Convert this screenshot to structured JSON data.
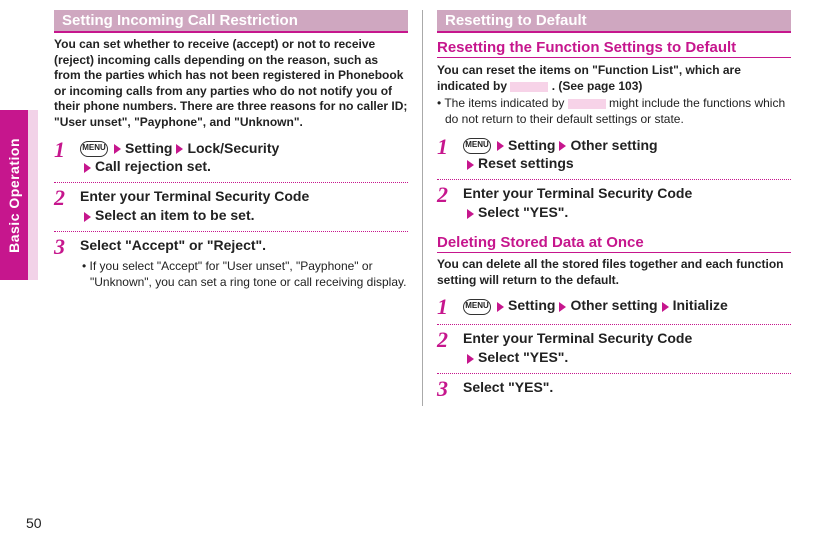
{
  "side_tab": "Basic Operation",
  "page_number": "50",
  "menu_label": "MENU",
  "left": {
    "head1": "Setting Incoming Call Restriction",
    "intro": "You can set whether to receive (accept) or not to receive (reject) incoming calls depending on the reason, such as from the parties which has not been registered in Phonebook or incoming calls from any parties who do not notify you of their phone numbers. There are three reasons for no caller ID; \"User unset\", \"Payphone\", and \"Unknown\".",
    "steps": {
      "s1": {
        "num": "1",
        "p1": "Setting",
        "p2": "Lock/Security",
        "p3": "Call rejection set."
      },
      "s2": {
        "num": "2",
        "l1": "Enter your Terminal Security Code",
        "l2": "Select an item to be set."
      },
      "s3": {
        "num": "3",
        "l1": "Select \"Accept\" or \"Reject\".",
        "sub": "• If you select \"Accept\" for \"User unset\", \"Payphone\" or \"Unknown\", you can set a ring tone or call receiving display."
      }
    }
  },
  "right": {
    "head1": "Resetting to Default",
    "secA": {
      "head2": "Resetting the Function Settings to Default",
      "intro_before": "You can reset the items on \"Function List\", which are indicated by ",
      "intro_after": " . (See page 103)",
      "note_before": "• The items indicated by ",
      "note_after": " might include the functions which do not return to their default settings or state.",
      "steps": {
        "s1": {
          "num": "1",
          "p1": "Setting",
          "p2": "Other setting",
          "p3": "Reset settings"
        },
        "s2": {
          "num": "2",
          "l1": "Enter your Terminal Security Code",
          "l2": "Select \"YES\"."
        }
      }
    },
    "secB": {
      "head2": "Deleting Stored Data at Once",
      "intro": "You can delete all the stored files together and each function setting will return to the default.",
      "steps": {
        "s1": {
          "num": "1",
          "p1": "Setting",
          "p2": "Other setting",
          "p3": "Initialize"
        },
        "s2": {
          "num": "2",
          "l1": "Enter your Terminal Security Code",
          "l2": "Select \"YES\"."
        },
        "s3": {
          "num": "3",
          "l1": "Select \"YES\"."
        }
      }
    }
  }
}
